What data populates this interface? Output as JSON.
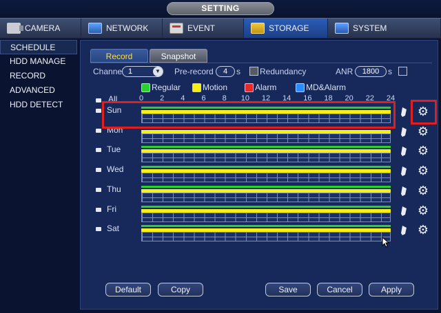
{
  "window": {
    "title": "SETTING"
  },
  "tabs": [
    {
      "label": "CAMERA",
      "icon": "camera-icon"
    },
    {
      "label": "NETWORK",
      "icon": "network-icon"
    },
    {
      "label": "EVENT",
      "icon": "event-icon"
    },
    {
      "label": "STORAGE",
      "icon": "storage-icon",
      "active": true
    },
    {
      "label": "SYSTEM",
      "icon": "system-icon"
    }
  ],
  "sidebar": {
    "items": [
      {
        "label": "SCHEDULE",
        "active": true
      },
      {
        "label": "HDD MANAGE"
      },
      {
        "label": "RECORD"
      },
      {
        "label": "ADVANCED"
      },
      {
        "label": "HDD DETECT"
      }
    ]
  },
  "subtabs": {
    "record": "Record",
    "snapshot": "Snapshot"
  },
  "controls": {
    "channel_label": "Channel",
    "channel_value": "1",
    "prerecord_label": "Pre-record",
    "prerecord_value": "4",
    "prerecord_unit": "s",
    "redundancy_label": "Redundancy",
    "anr_label": "ANR",
    "anr_value": "1800",
    "anr_unit": "s"
  },
  "legend": {
    "regular": "Regular",
    "motion": "Motion",
    "alarm": "Alarm",
    "md_alarm": "MD&Alarm",
    "colors": {
      "regular": "#2bd02e",
      "motion": "#f7ef17",
      "alarm": "#e52a2a",
      "md_alarm": "#2a8cff"
    }
  },
  "schedule": {
    "all_label": "All",
    "ticks": [
      "0",
      "2",
      "4",
      "6",
      "8",
      "10",
      "12",
      "14",
      "16",
      "18",
      "20",
      "22",
      "24"
    ],
    "days": [
      "Sun",
      "Mon",
      "Tue",
      "Wed",
      "Thu",
      "Fri",
      "Sat"
    ]
  },
  "buttons": {
    "default": "Default",
    "copy": "Copy",
    "save": "Save",
    "cancel": "Cancel",
    "apply": "Apply"
  }
}
